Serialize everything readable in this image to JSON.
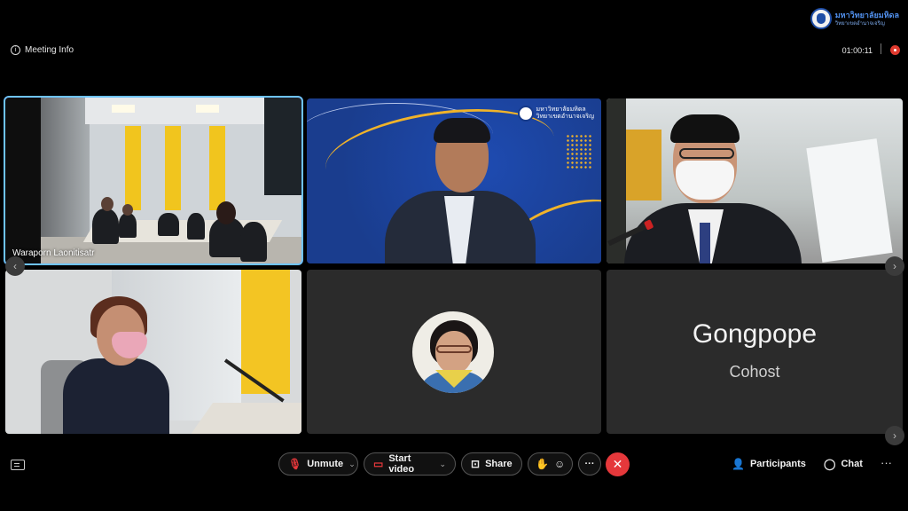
{
  "header": {
    "meeting_info_label": "Meeting Info",
    "timer": "01:00:11",
    "brand_line1": "มหาวิทยาลัยมหิดล",
    "brand_line2": "วิทยาเขตอำนาจเจริญ"
  },
  "tiles": [
    {
      "name_label": "Waraporn Laonitisatr",
      "active_speaker": true
    },
    {
      "name_label": ""
    },
    {
      "name_label": ""
    },
    {
      "name_label": ""
    },
    {
      "name_label": ""
    },
    {
      "display_name": "Gongpope",
      "role": "Cohost",
      "video": false
    }
  ],
  "toolbar": {
    "unmute_label": "Unmute",
    "start_video_label": "Start video",
    "share_label": "Share",
    "more_label": "···",
    "leave_icon": "close-icon",
    "participants_label": "Participants",
    "chat_label": "Chat",
    "overflow_label": "···"
  },
  "colors": {
    "background": "#000000",
    "leave_red": "#e5383b",
    "active_border": "#6ec3ff",
    "record_red": "#e03a2f"
  }
}
